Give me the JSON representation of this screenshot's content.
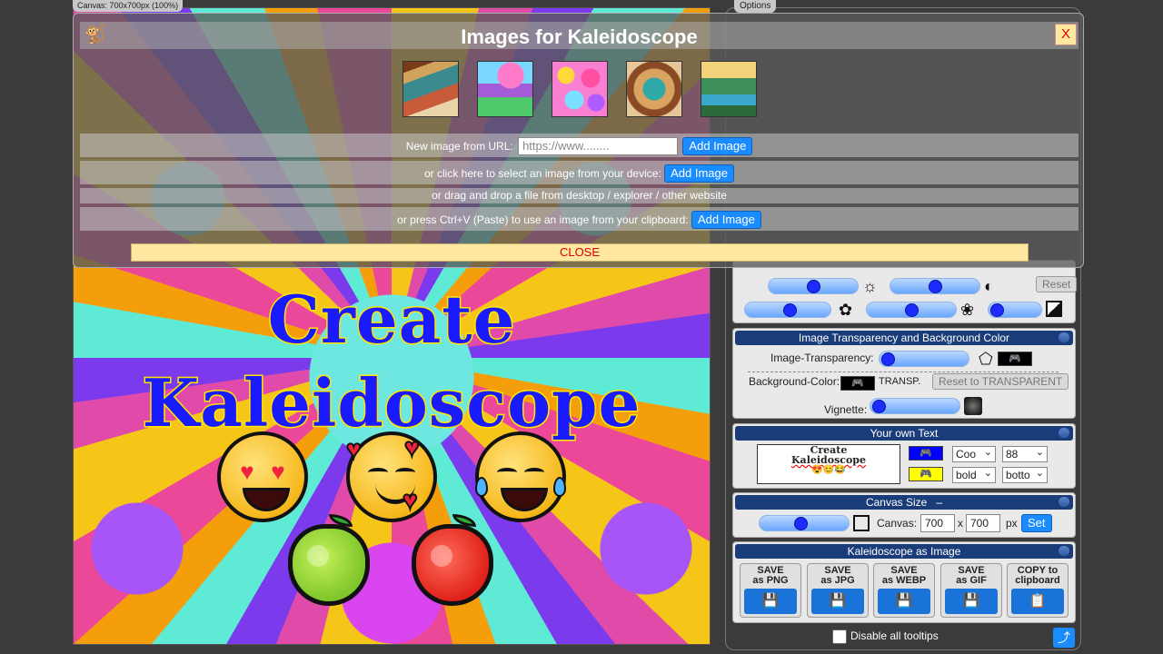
{
  "canvas": {
    "label": "Canvas: 700x700px (100%)",
    "text_line1": "Create",
    "text_line2": "Kaleidoscope"
  },
  "options": {
    "tab_label": "Options",
    "image_filters": {
      "reset_label": "Reset"
    },
    "transparency": {
      "header": "Image Transparency and Background Color",
      "image_transparency_label": "Image-Transparency:",
      "background_color_label": "Background-Color:",
      "transp_label": "TRANSP.",
      "reset_transparent_label": "Reset to TRANSPARENT",
      "vignette_label": "Vignette:"
    },
    "own_text": {
      "header": "Your own Text",
      "preview_line1": "Create",
      "preview_line2": "Kaleidoscope",
      "font_select": "Coo",
      "size_select": "88",
      "weight_select": "bold",
      "position_select": "botto"
    },
    "canvas_size": {
      "header": "Canvas Size",
      "header_suffix": "–",
      "canvas_label": "Canvas:",
      "width": "700",
      "x_label": "x",
      "height": "700",
      "px_label": "px",
      "set_label": "Set"
    },
    "save": {
      "header": "Kaleidoscope as Image",
      "buttons": [
        {
          "line1": "SAVE",
          "line2": "as PNG"
        },
        {
          "line1": "SAVE",
          "line2": "as JPG"
        },
        {
          "line1": "SAVE",
          "line2": "as WEBP"
        },
        {
          "line1": "SAVE",
          "line2": "as GIF"
        },
        {
          "line1": "COPY to",
          "line2": "clipboard"
        }
      ]
    },
    "disable_tooltips_label": "Disable all tooltips"
  },
  "modal": {
    "title": "Images for Kaleidoscope",
    "close_x": "X",
    "url_row_label": "New image from URL:",
    "url_placeholder": "https://www........",
    "add_image_label": "Add Image",
    "device_row_label": "or click here to select an image from your device:",
    "drag_row_label": "or drag and drop a file from desktop / explorer / other website",
    "paste_row_label": "or press Ctrl+V (Paste) to use an image from your clipboard:",
    "close_label": "CLOSE",
    "thumbnails": [
      "pottery-thumbnail",
      "fantasy-mushroom-thumbnail",
      "flowers-thumbnail",
      "ornament-thumbnail",
      "landscape-thumbnail"
    ]
  }
}
